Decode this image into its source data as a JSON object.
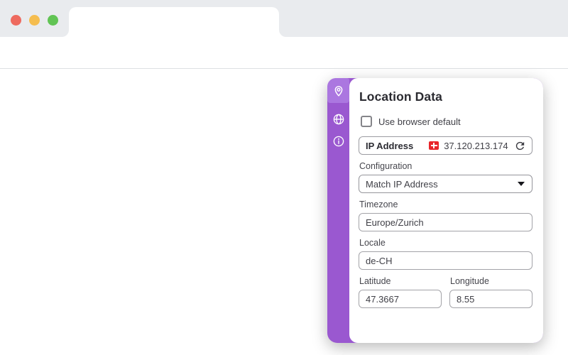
{
  "browser": {
    "toolbar": {
      "url_value": ""
    },
    "window_controls": [
      "close",
      "minimize",
      "zoom"
    ]
  },
  "popup": {
    "title": "Location Data",
    "default_checkbox": {
      "label": "Use browser default",
      "checked": false
    },
    "ip": {
      "label": "IP Address",
      "value": "37.120.213.174",
      "country_flag": "CH"
    },
    "configuration": {
      "label": "Configuration",
      "value": "Match IP Address"
    },
    "timezone": {
      "label": "Timezone",
      "value": "Europe/Zurich"
    },
    "locale": {
      "label": "Locale",
      "value": "de-CH"
    },
    "latitude": {
      "label": "Latitude",
      "value": "47.3667"
    },
    "longitude": {
      "label": "Longitude",
      "value": "8.55"
    },
    "sidebar": {
      "items": [
        {
          "icon": "location-pin-icon",
          "active": true
        },
        {
          "icon": "globe-icon",
          "active": false
        },
        {
          "icon": "info-icon",
          "active": false
        }
      ]
    }
  },
  "colors": {
    "sidebar_purple": "#9a58d0",
    "sidebar_active_purple": "#ab77e0",
    "logo_purple": "#7e3bdf",
    "flag_red": "#e8252a",
    "traffic_red": "#ee6a5f",
    "traffic_yellow": "#f5bd4f",
    "traffic_green": "#61c454"
  }
}
